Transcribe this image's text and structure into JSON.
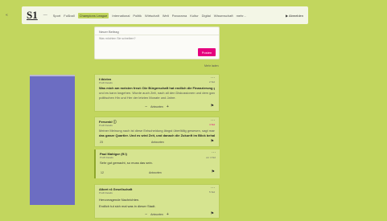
{
  "nav": {
    "logo": "S1",
    "separator": "—",
    "items": [
      "Sport",
      "Fußball",
      "Champions League",
      "International",
      "Politik",
      "Wirtschaft",
      "Welt",
      "Panorama",
      "Kultur",
      "Digital",
      "Wissenschaft",
      "mehr..."
    ],
    "active_index": 2,
    "right_label": "▶ Abmelden",
    "left_arrow": "«"
  },
  "composer": {
    "title": "Neuer Beitrag",
    "placeholder": "Was möchten Sie schreiben?",
    "post_label": "Posten"
  },
  "more_link": "Mehr laden",
  "posts": [
    {
      "author": "f.thielen",
      "handle": "Profil Details",
      "time": "2 Std",
      "menu": "···",
      "lines": [
        "Was mich am meisten freut: Die Bürgerschaft hat endlich die Finanzierung genehmigt",
        "und es kann losgehen. Wurde auch Zeit, nach all den Diskussionen und dem ganzen",
        "politischen Hin und Her der letzten Monate und Jahre."
      ],
      "answer_label": "Antworten",
      "vote_up": "+",
      "vote_down": "−",
      "flag": "⚑"
    },
    {
      "author": "Fersenkl ⓘ",
      "handle": "Profil Details",
      "time": "4 Std",
      "menu": "···",
      "lines": [
        "Meiner Meinung nach ist diese Entscheidung längst überfällig gewesen, sagt man",
        "das ganze Quartier. Und es wird Zeit, und danach die Zukunft im Blick behalten..."
      ],
      "count": "23",
      "answer_label": "Antworten",
      "flag": "⚑"
    },
    {
      "author": "Albert r4 Gesellschaft",
      "handle": "Profil Details",
      "time": "5 Std",
      "menu": "···",
      "lines": [
        "Hervorragende Nachrichten.",
        "Endlich tut sich mal was in dieser Stadt."
      ],
      "answer_label": "Antworten",
      "vote_up": "+",
      "vote_down": "−",
      "flag": "⚑"
    }
  ],
  "quoted": {
    "author": "Paul Mahlgor (ff.l)",
    "handle": "Profil Details",
    "time": "vor 4 Std",
    "menu": "···",
    "line": "Sehr gut gemacht, so muss das sein.",
    "count": "12",
    "answer_label": "Antworten",
    "flag": "⚑"
  }
}
